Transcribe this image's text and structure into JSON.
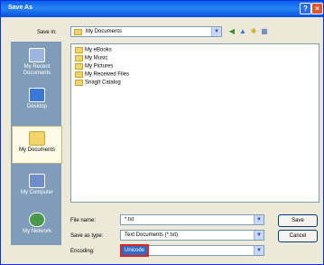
{
  "window": {
    "title": "Save As",
    "help": "?",
    "close": "×"
  },
  "savein": {
    "label": "Save in:",
    "value": "My Documents"
  },
  "places": [
    {
      "label": "My Recent Documents"
    },
    {
      "label": "Desktop"
    },
    {
      "label": "My Documents"
    },
    {
      "label": "My Computer"
    },
    {
      "label": "My Network"
    }
  ],
  "files": [
    "My eBooks",
    "My Music",
    "My Pictures",
    "My Received Files",
    "SnagIt Catalog"
  ],
  "form": {
    "filename_label": "File name:",
    "filename_value": "*.txt",
    "saveas_label": "Save as type:",
    "saveas_value": "Text Documents (*.txt)",
    "encoding_label": "Encoding:",
    "encoding_value": "Unicode"
  },
  "buttons": {
    "save": "Save",
    "cancel": "Cancel"
  },
  "colors": {
    "highlight_box": "#e1261c",
    "selection": "#316ac5"
  }
}
